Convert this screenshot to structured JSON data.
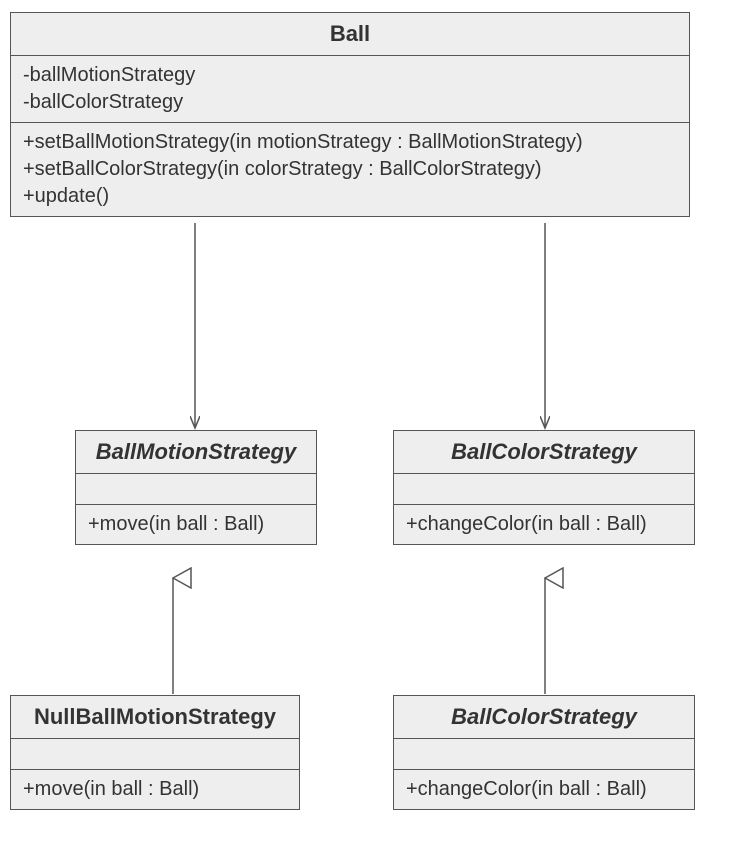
{
  "classes": {
    "ball": {
      "name": "Ball",
      "attrs": [
        "-ballMotionStrategy",
        "-ballColorStrategy"
      ],
      "ops": [
        "+setBallMotionStrategy(in motionStrategy : BallMotionStrategy)",
        "+setBallColorStrategy(in colorStrategy : BallColorStrategy)",
        "+update()"
      ]
    },
    "motion": {
      "name": "BallMotionStrategy",
      "ops": [
        "+move(in ball : Ball)"
      ]
    },
    "color": {
      "name": "BallColorStrategy",
      "ops": [
        "+changeColor(in ball : Ball)"
      ]
    },
    "nullMotion": {
      "name": "NullBallMotionStrategy",
      "ops": [
        "+move(in ball : Ball)"
      ]
    },
    "color2": {
      "name": "BallColorStrategy",
      "ops": [
        "+changeColor(in ball : Ball)"
      ]
    }
  }
}
